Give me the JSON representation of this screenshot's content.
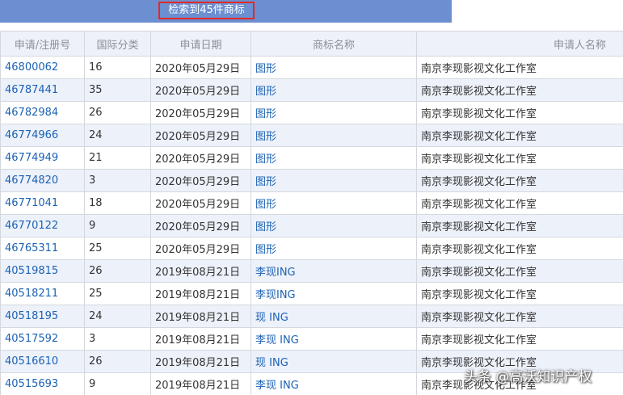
{
  "header": {
    "result_count": "检索到45件商标"
  },
  "table": {
    "columns": [
      "申请/注册号",
      "国际分类",
      "申请日期",
      "商标名称",
      "申请人名称"
    ],
    "rows": [
      {
        "reg": "46800062",
        "cls": "16",
        "date": "2020年05月29日",
        "name": "图形",
        "applicant": "南京李现影视文化工作室"
      },
      {
        "reg": "46787441",
        "cls": "35",
        "date": "2020年05月29日",
        "name": "图形",
        "applicant": "南京李现影视文化工作室"
      },
      {
        "reg": "46782984",
        "cls": "26",
        "date": "2020年05月29日",
        "name": "图形",
        "applicant": "南京李现影视文化工作室"
      },
      {
        "reg": "46774966",
        "cls": "24",
        "date": "2020年05月29日",
        "name": "图形",
        "applicant": "南京李现影视文化工作室"
      },
      {
        "reg": "46774949",
        "cls": "21",
        "date": "2020年05月29日",
        "name": "图形",
        "applicant": "南京李现影视文化工作室"
      },
      {
        "reg": "46774820",
        "cls": "3",
        "date": "2020年05月29日",
        "name": "图形",
        "applicant": "南京李现影视文化工作室"
      },
      {
        "reg": "46771041",
        "cls": "18",
        "date": "2020年05月29日",
        "name": "图形",
        "applicant": "南京李现影视文化工作室"
      },
      {
        "reg": "46770122",
        "cls": "9",
        "date": "2020年05月29日",
        "name": "图形",
        "applicant": "南京李现影视文化工作室"
      },
      {
        "reg": "46765311",
        "cls": "25",
        "date": "2020年05月29日",
        "name": "图形",
        "applicant": "南京李现影视文化工作室"
      },
      {
        "reg": "40519815",
        "cls": "26",
        "date": "2019年08月21日",
        "name": "李现ING",
        "applicant": "南京李现影视文化工作室"
      },
      {
        "reg": "40518211",
        "cls": "25",
        "date": "2019年08月21日",
        "name": "李现ING",
        "applicant": "南京李现影视文化工作室"
      },
      {
        "reg": "40518195",
        "cls": "24",
        "date": "2019年08月21日",
        "name": "现 ING",
        "applicant": "南京李现影视文化工作室"
      },
      {
        "reg": "40517592",
        "cls": "3",
        "date": "2019年08月21日",
        "name": "李现 ING",
        "applicant": "南京李现影视文化工作室"
      },
      {
        "reg": "40516610",
        "cls": "26",
        "date": "2019年08月21日",
        "name": "现 ING",
        "applicant": "南京李现影视文化工作室"
      },
      {
        "reg": "40515693",
        "cls": "9",
        "date": "2019年08月21日",
        "name": "李现 ING",
        "applicant": "南京李现影视文化工作室"
      }
    ]
  },
  "watermark": "头条 @高沃知识产权"
}
